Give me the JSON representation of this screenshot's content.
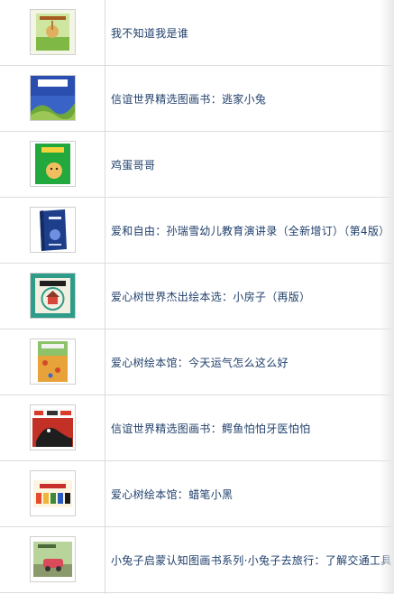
{
  "books": [
    {
      "title": "我不知道我是谁",
      "cover_icon": "book-cover-rabbit-field-icon"
    },
    {
      "title": "信谊世界精选图画书：逃家小兔",
      "cover_icon": "book-cover-runaway-bunny-icon"
    },
    {
      "title": "鸡蛋哥哥",
      "cover_icon": "book-cover-egg-brother-icon"
    },
    {
      "title": "爱和自由：孙瑞雪幼儿教育演讲录（全新增订）（第4版）",
      "cover_icon": "book-cover-love-freedom-icon"
    },
    {
      "title": "爱心树世界杰出绘本选：小房子（再版）",
      "cover_icon": "book-cover-little-house-icon"
    },
    {
      "title": "爱心树绘本馆：今天运气怎么这么好",
      "cover_icon": "book-cover-lucky-day-icon"
    },
    {
      "title": "信谊世界精选图画书：鳄鱼怕怕牙医怕怕",
      "cover_icon": "book-cover-crocodile-dentist-icon"
    },
    {
      "title": "爱心树绘本馆：蜡笔小黑",
      "cover_icon": "book-cover-black-crayon-icon"
    },
    {
      "title": "小兔子启蒙认知图画书系列·小兔子去旅行：了解交通工具",
      "cover_icon": "book-cover-bunny-travel-icon"
    }
  ],
  "colors": {
    "title_text": "#1f3f6b",
    "row_border": "#dcdcdc"
  }
}
